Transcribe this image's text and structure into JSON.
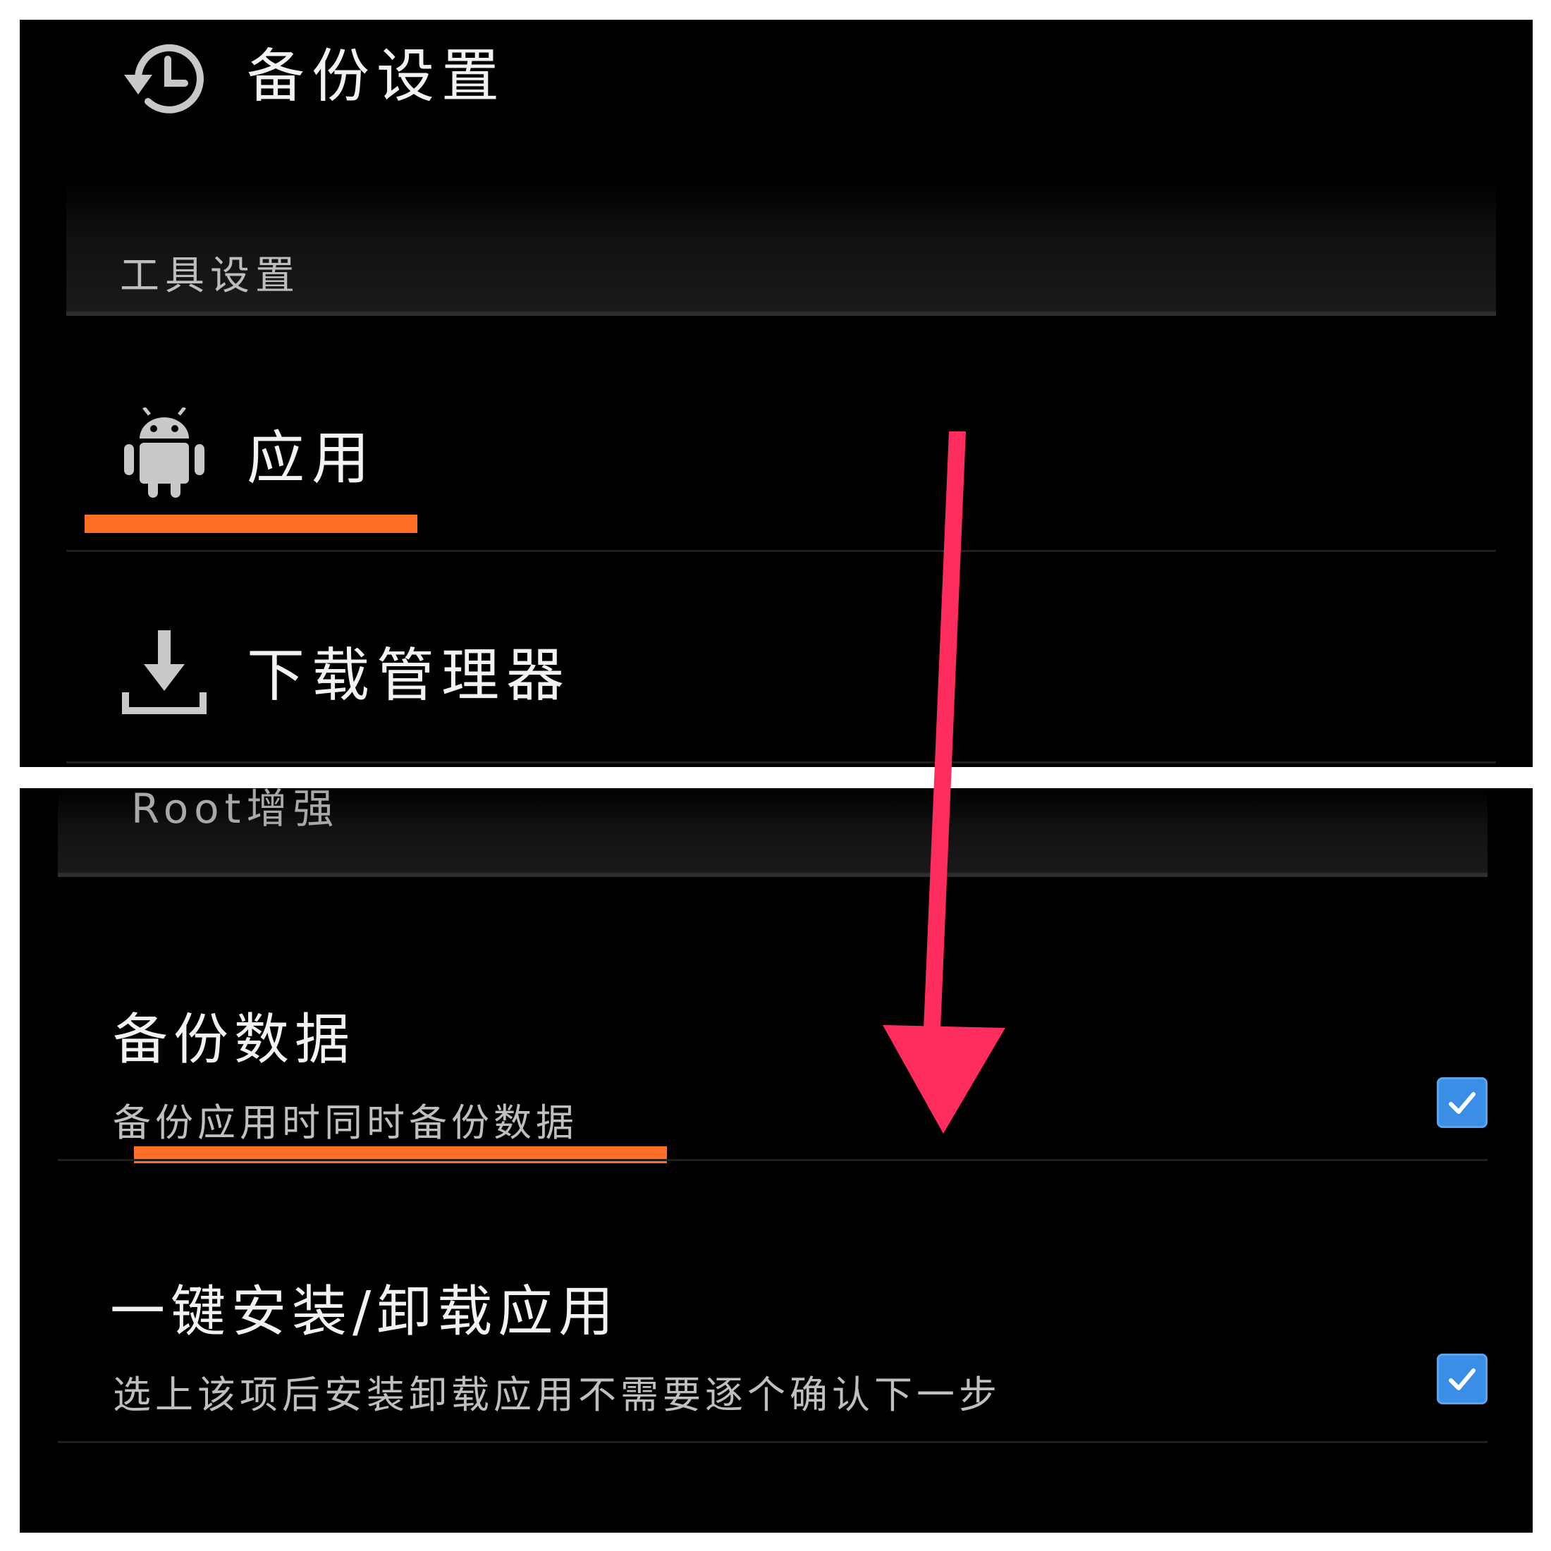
{
  "top_panel": {
    "backup_settings_label": "备份设置",
    "tool_settings_header": "工具设置",
    "apps_label": "应用",
    "download_manager_label": "下载管理器"
  },
  "bottom_panel": {
    "root_header": "Root增强",
    "backup_data": {
      "title": "备份数据",
      "description": "备份应用时同时备份数据",
      "checked": true
    },
    "one_click_install": {
      "title": "一键安装/卸载应用",
      "description": "选上该项后安装卸载应用不需要逐个确认下一步",
      "checked": true
    }
  },
  "icons": {
    "backup": "history-icon",
    "apps": "android-icon",
    "download": "download-icon",
    "check": "check-icon"
  },
  "colors": {
    "background": "#000000",
    "highlight_underline": "#ff6f25",
    "annotation_arrow": "#ff2d5e",
    "checkbox": "#3a8ee6",
    "text_primary": "#f2f2f2",
    "text_secondary": "#bfbfbf"
  }
}
